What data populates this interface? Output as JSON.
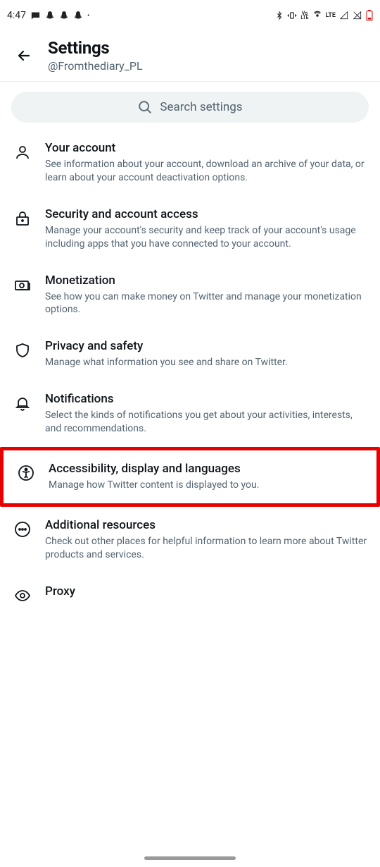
{
  "statusbar": {
    "time": "4:47",
    "lte": "LTE",
    "volte": "Vo LTE"
  },
  "header": {
    "title": "Settings",
    "handle": "@Fromthediary_PL"
  },
  "search": {
    "placeholder": "Search settings"
  },
  "items": [
    {
      "title": "Your account",
      "desc": "See information about your account, download an archive of your data, or learn about your account deactivation options."
    },
    {
      "title": "Security and account access",
      "desc": "Manage your account's security and keep track of your account's usage including apps that you have connected to your account."
    },
    {
      "title": "Monetization",
      "desc": "See how you can make money on Twitter and manage your monetization options."
    },
    {
      "title": "Privacy and safety",
      "desc": "Manage what information you see and share on Twitter."
    },
    {
      "title": "Notifications",
      "desc": "Select the kinds of notifications you get about your activities, interests, and recommendations."
    },
    {
      "title": "Accessibility, display and languages",
      "desc": "Manage how Twitter content is displayed to you."
    },
    {
      "title": "Additional resources",
      "desc": "Check out other places for helpful information to learn more about Twitter products and services."
    },
    {
      "title": "Proxy",
      "desc": ""
    }
  ]
}
